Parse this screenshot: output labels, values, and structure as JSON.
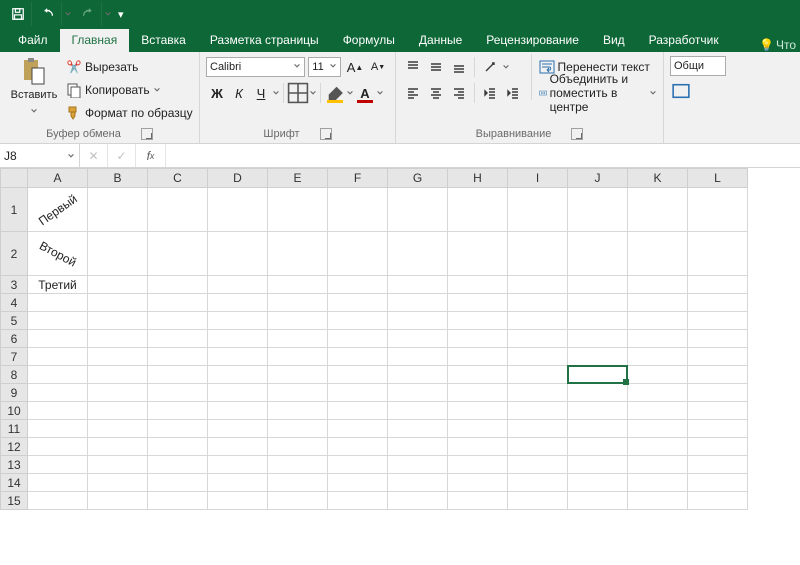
{
  "qat": {
    "tooltip_save": "Save",
    "tooltip_undo": "Undo",
    "tooltip_redo": "Redo"
  },
  "tabs": {
    "file": "Файл",
    "home": "Главная",
    "insert": "Вставка",
    "pagelayout": "Разметка страницы",
    "formulas": "Формулы",
    "data": "Данные",
    "review": "Рецензирование",
    "view": "Вид",
    "developer": "Разработчик",
    "tell_me": "Что"
  },
  "clipboard": {
    "paste": "Вставить",
    "cut": "Вырезать",
    "copy": "Копировать",
    "format_painter": "Формат по образцу",
    "group_label": "Буфер обмена"
  },
  "font": {
    "name": "Calibri",
    "size": "11",
    "group_label": "Шрифт"
  },
  "alignment": {
    "wrap": "Перенести текст",
    "merge": "Объединить и поместить в центре",
    "group_label": "Выравнивание"
  },
  "number": {
    "general": "Общи"
  },
  "namebox": "J8",
  "cells": {
    "A1": "Первый",
    "A2": "Второй",
    "A3": "Третий"
  },
  "columns": [
    "A",
    "B",
    "C",
    "D",
    "E",
    "F",
    "G",
    "H",
    "I",
    "J",
    "K",
    "L"
  ],
  "rows": [
    "1",
    "2",
    "3",
    "4",
    "5",
    "6",
    "7",
    "8",
    "9",
    "10",
    "11",
    "12",
    "13",
    "14",
    "15"
  ],
  "active": {
    "col": 10,
    "row": 8
  }
}
